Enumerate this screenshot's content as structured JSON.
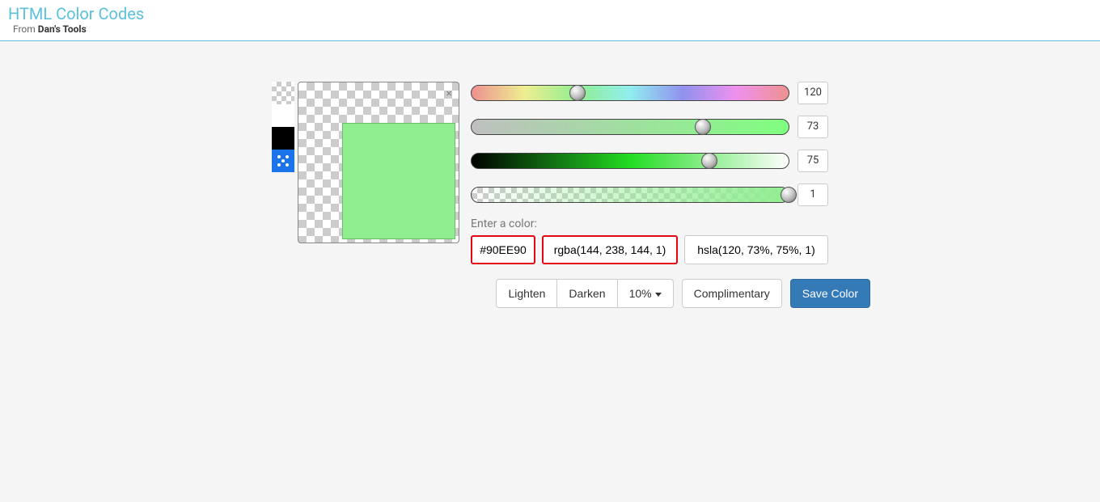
{
  "header": {
    "title": "HTML Color Codes",
    "subtitle_prefix": "From ",
    "subtitle_bold": "Dan's Tools"
  },
  "sliders": {
    "hue": {
      "value": "120",
      "pos_pct": 33.3
    },
    "sat": {
      "value": "73",
      "pos_pct": 73
    },
    "light": {
      "value": "75",
      "pos_pct": 75
    },
    "alpha": {
      "value": "1",
      "pos_pct": 100
    }
  },
  "enter_label": "Enter a color:",
  "inputs": {
    "hex": "#90EE90",
    "rgba": "rgba(144, 238, 144, 1)",
    "hsla": "hsla(120, 73%, 75%, 1)"
  },
  "buttons": {
    "lighten": "Lighten",
    "darken": "Darken",
    "percent": "10%",
    "complimentary": "Complimentary",
    "save": "Save Color"
  },
  "current_color": "#90EE90"
}
